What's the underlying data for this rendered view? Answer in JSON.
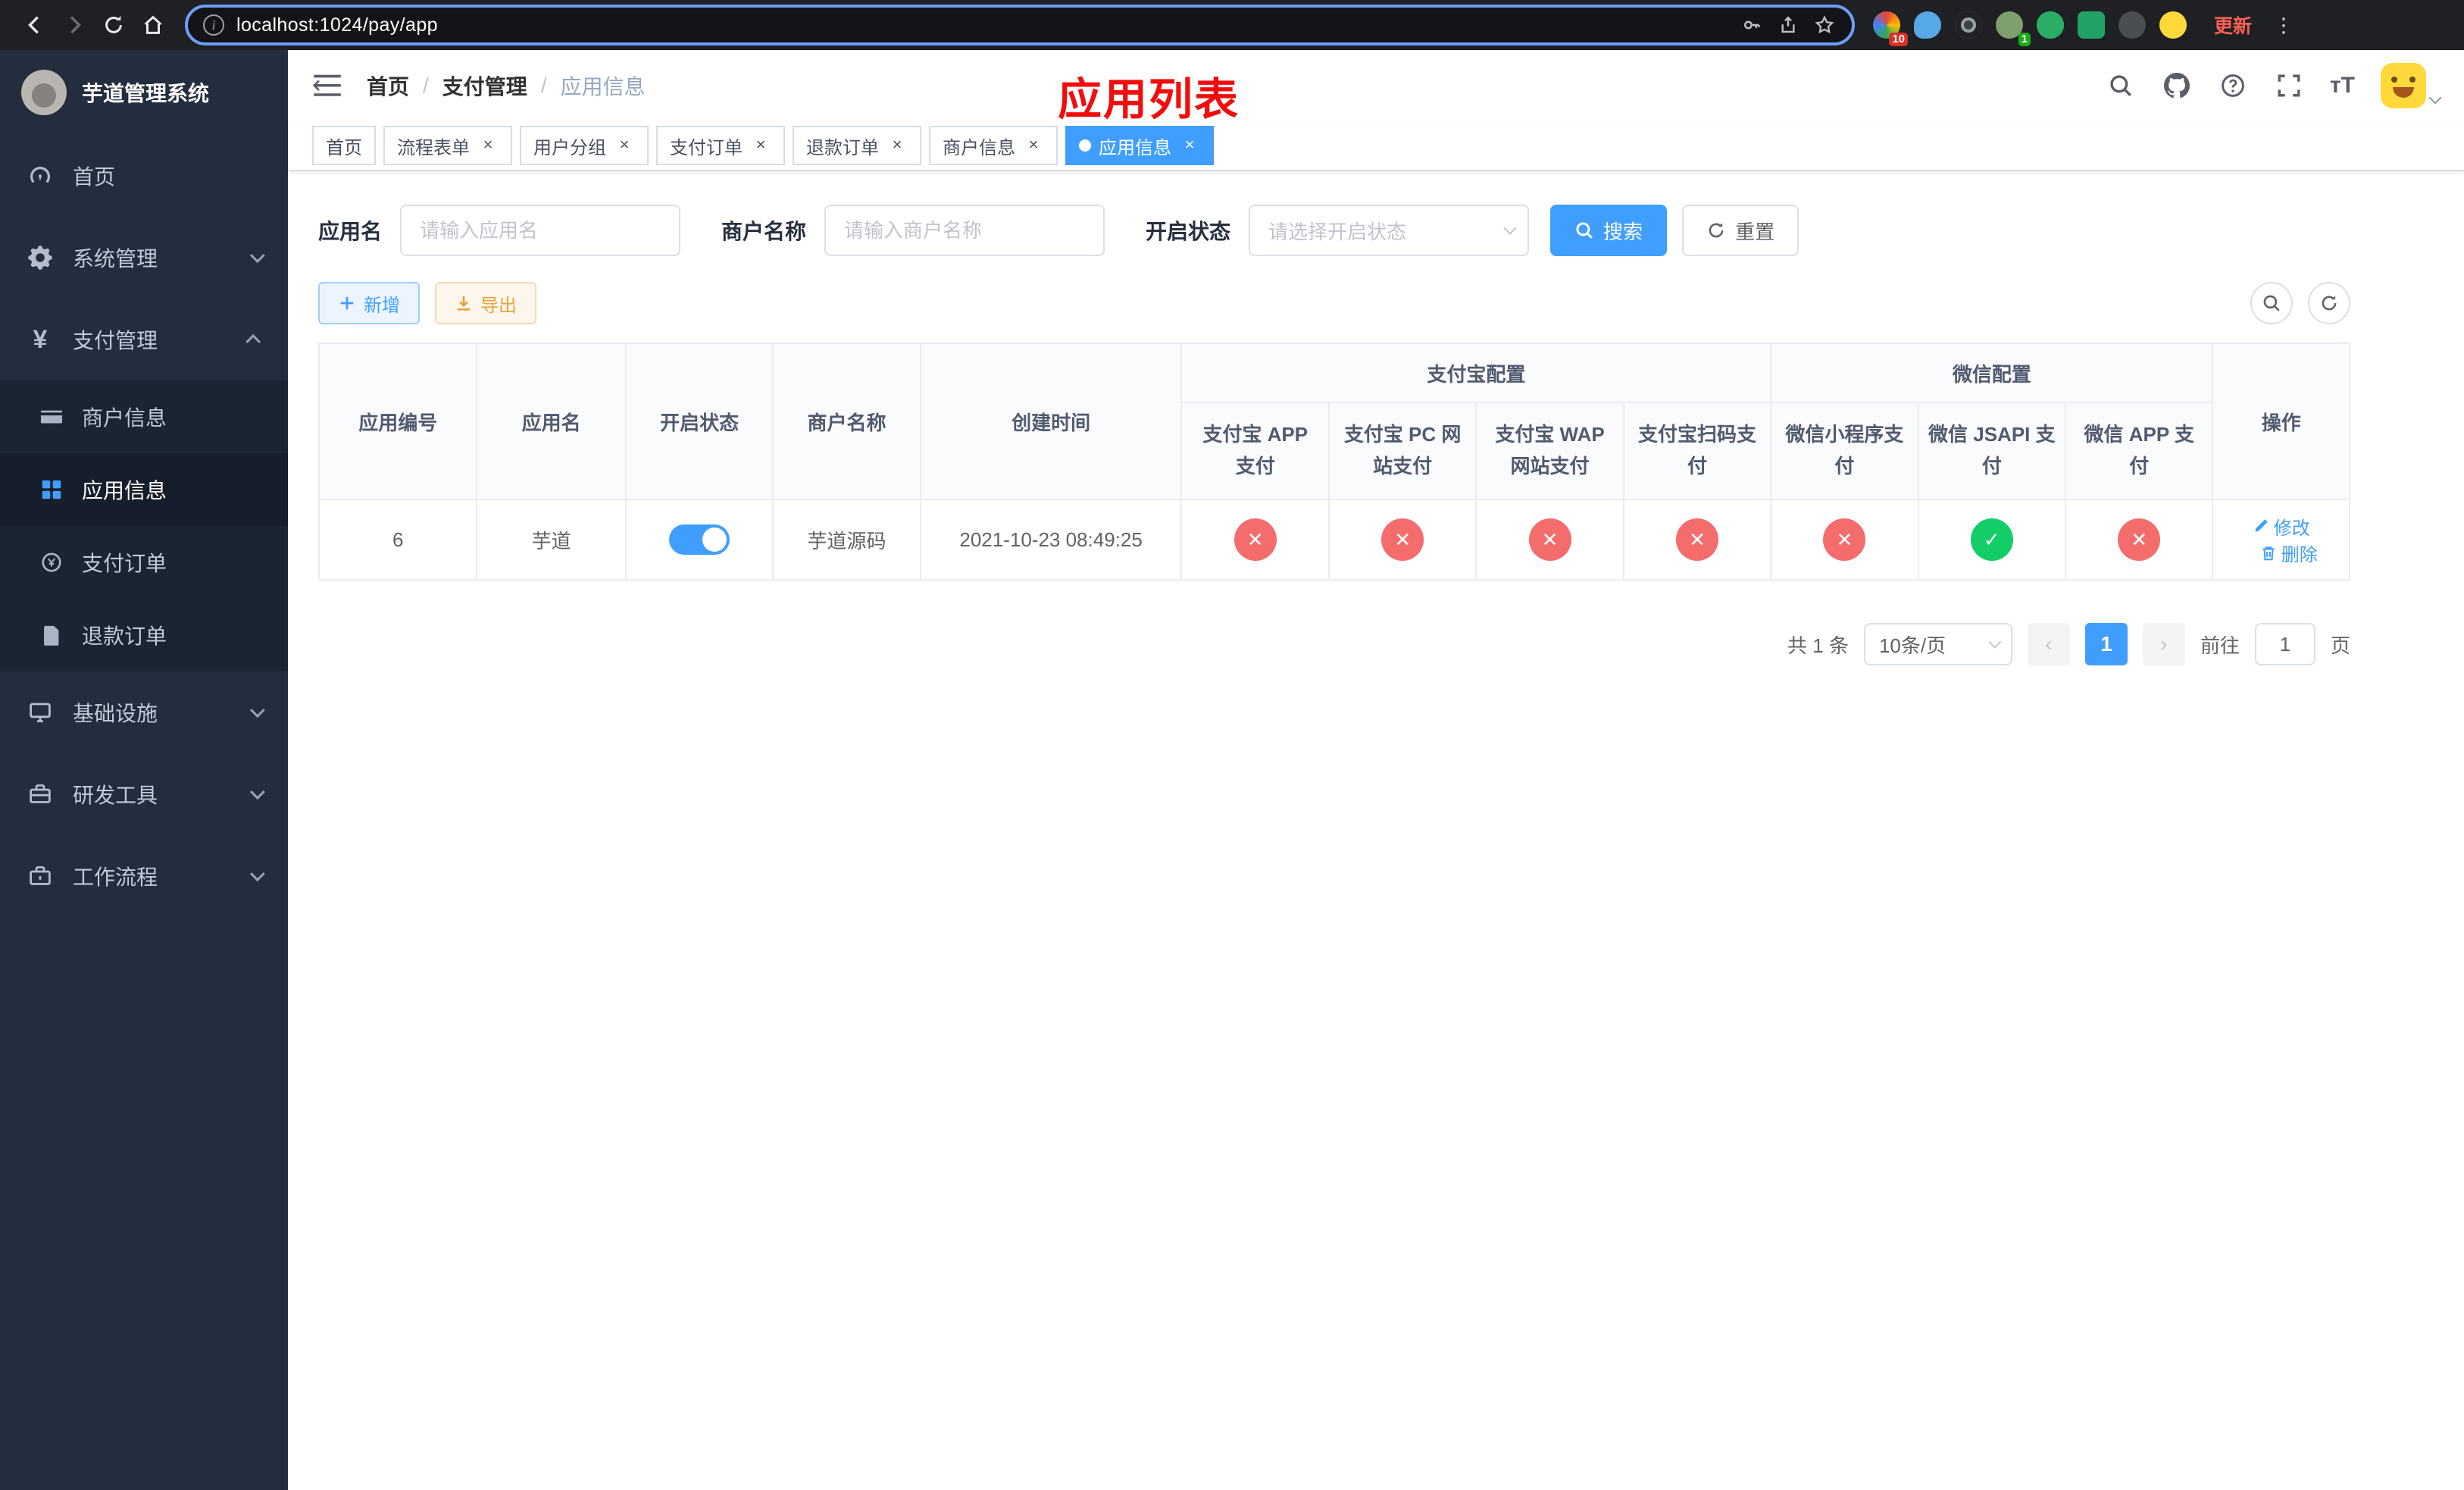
{
  "colors": {
    "accent": "#409eff",
    "danger": "#f56c6c",
    "success": "#13ce66",
    "warning": "#e6a23c",
    "title_red": "#f20d0d"
  },
  "browser": {
    "url": "localhost:1024/pay/app",
    "update_button": "更新",
    "extensions_badge": "10",
    "profile_badge": "1"
  },
  "sidebar": {
    "title": "芋道管理系统",
    "menu": [
      {
        "label": "首页"
      },
      {
        "label": "系统管理"
      },
      {
        "label": "支付管理"
      },
      {
        "label": "基础设施"
      },
      {
        "label": "研发工具"
      },
      {
        "label": "工作流程"
      }
    ],
    "payment_submenu": [
      {
        "label": "商户信息"
      },
      {
        "label": "应用信息"
      },
      {
        "label": "支付订单"
      },
      {
        "label": "退款订单"
      }
    ]
  },
  "header": {
    "breadcrumb": [
      "首页",
      "支付管理",
      "应用信息"
    ],
    "title": "应用列表"
  },
  "tabs": [
    {
      "label": "首页"
    },
    {
      "label": "流程表单"
    },
    {
      "label": "用户分组"
    },
    {
      "label": "支付订单"
    },
    {
      "label": "退款订单"
    },
    {
      "label": "商户信息"
    },
    {
      "label": "应用信息"
    }
  ],
  "filters": {
    "app_name_label": "应用名",
    "app_name_placeholder": "请输入应用名",
    "merchant_label": "商户名称",
    "merchant_placeholder": "请输入商户名称",
    "status_label": "开启状态",
    "status_placeholder": "请选择开启状态",
    "search_button": "搜索",
    "reset_button": "重置"
  },
  "toolbar": {
    "add_button": "新增",
    "export_button": "导出"
  },
  "table": {
    "columns": {
      "id": "应用编号",
      "name": "应用名",
      "status": "开启状态",
      "merchant": "商户名称",
      "created": "创建时间",
      "ops": "操作"
    },
    "groups": {
      "alipay": "支付宝配置",
      "wechat": "微信配置"
    },
    "sub_columns": [
      "支付宝 APP 支付",
      "支付宝 PC 网站支付",
      "支付宝 WAP 网站支付",
      "支付宝扫码支付",
      "微信小程序支付",
      "微信 JSAPI 支付",
      "微信 APP 支付"
    ],
    "rows": [
      {
        "id": "6",
        "name": "芋道",
        "enabled": true,
        "merchant": "芋道源码",
        "created": "2021-10-23 08:49:25",
        "configs": [
          false,
          false,
          false,
          false,
          false,
          true,
          false
        ],
        "edit_link": "修改",
        "delete_link": "删除"
      }
    ]
  },
  "pagination": {
    "total": "共 1 条",
    "page_size": "10条/页",
    "page": "1",
    "goto_label": "前往",
    "goto_value": "1",
    "goto_unit": "页"
  }
}
